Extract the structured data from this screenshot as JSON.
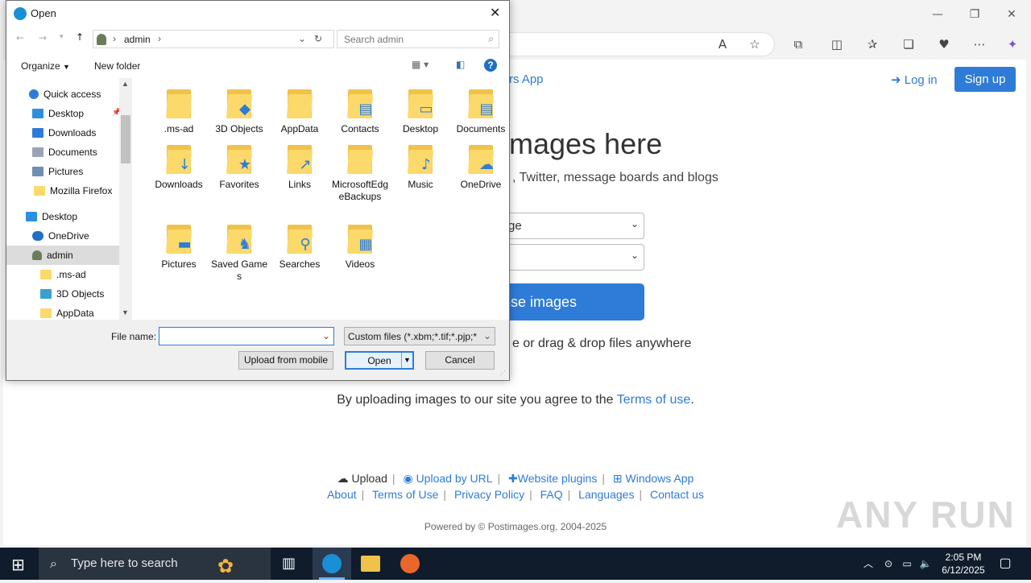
{
  "browser": {
    "toolbar_icons": [
      "read-aloud-icon",
      "favorite-star-icon",
      "extensions-icon",
      "split-screen-icon",
      "favorites-icon",
      "collections-icon",
      "performance-icon",
      "more-icon",
      "copilot-icon"
    ]
  },
  "site": {
    "app_link": "rs App",
    "login": "Log in",
    "signup": "Sign up",
    "headline": "mages here",
    "subhead": ", Twitter, message boards and blogs",
    "select1": "ge",
    "select2": "",
    "choose_button": "ose images",
    "drag_text": "e or drag & drop files anywhere",
    "agree_prefix": "By uploading images to our site you agree to the ",
    "agree_link": "Terms of use",
    "agree_suffix": ".",
    "footer_row1": {
      "upload": "Upload",
      "upload_url": "Upload by URL",
      "plugins": "Website plugins",
      "windows_app": "Windows App"
    },
    "footer_row2": [
      "About",
      "Terms of Use",
      "Privacy Policy",
      "FAQ",
      "Languages",
      "Contact us"
    ],
    "powered": "Powered by © Postimages.org, 2004-2025",
    "watermark": "ANY RUN"
  },
  "dialog": {
    "title": "Open",
    "breadcrumb": [
      "admin"
    ],
    "search_placeholder": "Search admin",
    "organize": "Organize",
    "new_folder": "New folder",
    "nav_items": [
      {
        "label": "Quick access",
        "color": "#2e7cd8"
      },
      {
        "label": "Desktop",
        "color": "#2d8fe0"
      },
      {
        "label": "Downloads",
        "color": "#2e7cd8"
      },
      {
        "label": "Documents",
        "color": "#9aa5b3"
      },
      {
        "label": "Pictures",
        "color": "#6f8fb0"
      },
      {
        "label": "Mozilla Firefox",
        "color": "#fbd96b"
      },
      {
        "label": "Desktop",
        "color": "#2d8fe0"
      },
      {
        "label": "OneDrive",
        "color": "#1f6fc7"
      },
      {
        "label": "admin",
        "color": "#6a7c5a"
      },
      {
        "label": ".ms-ad",
        "color": "#fbd96b"
      },
      {
        "label": "3D Objects",
        "color": "#3aa0d0"
      },
      {
        "label": "AppData",
        "color": "#fbd96b"
      }
    ],
    "files": [
      {
        "label": ".ms-ad",
        "icon": "folder-icon",
        "ov": ""
      },
      {
        "label": "3D Objects",
        "icon": "folder-3d-objects-icon",
        "ov": "◆"
      },
      {
        "label": "AppData",
        "icon": "folder-icon",
        "ov": ""
      },
      {
        "label": "Contacts",
        "icon": "folder-contacts-icon",
        "ov": "▤"
      },
      {
        "label": "Desktop",
        "icon": "folder-desktop-icon",
        "ov": "▭"
      },
      {
        "label": "Documents",
        "icon": "folder-documents-icon",
        "ov": "▤"
      },
      {
        "label": "Downloads",
        "icon": "folder-downloads-icon",
        "ov": "↓"
      },
      {
        "label": "Favorites",
        "icon": "folder-favorites-icon",
        "ov": "★"
      },
      {
        "label": "Links",
        "icon": "folder-links-icon",
        "ov": "↗"
      },
      {
        "label": "MicrosoftEdgeBackups",
        "icon": "folder-icon",
        "ov": ""
      },
      {
        "label": "Music",
        "icon": "folder-music-icon",
        "ov": "♪"
      },
      {
        "label": "OneDrive",
        "icon": "folder-onedrive-icon",
        "ov": "☁"
      },
      {
        "label": "Pictures",
        "icon": "folder-pictures-icon",
        "ov": "▬"
      },
      {
        "label": "Saved Games",
        "icon": "folder-saved-games-icon",
        "ov": "♞"
      },
      {
        "label": "Searches",
        "icon": "folder-searches-icon",
        "ov": "⚲"
      },
      {
        "label": "Videos",
        "icon": "folder-videos-icon",
        "ov": "▦"
      }
    ],
    "file_name_label": "File name:",
    "file_name_value": "",
    "file_type": "Custom files (*.xbm;*.tif;*.pjp;*",
    "upload_mobile": "Upload from mobile",
    "open": "Open",
    "cancel": "Cancel"
  },
  "taskbar": {
    "search_placeholder": "Type here to search",
    "time": "2:05 PM",
    "date": "6/12/2025"
  }
}
